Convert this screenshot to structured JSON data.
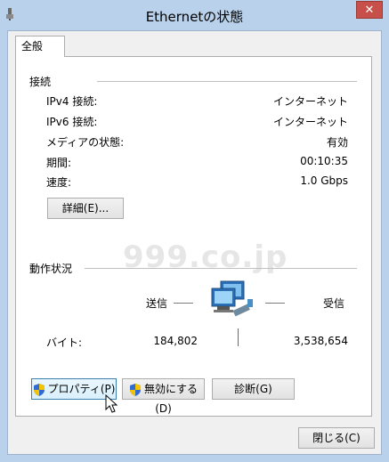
{
  "window": {
    "title": "Ethernetの状態",
    "close_label": "✕"
  },
  "tabs": [
    {
      "label": "全般"
    }
  ],
  "connection": {
    "group_title": "接続",
    "rows": [
      {
        "label": "IPv4 接続:",
        "value": "インターネット"
      },
      {
        "label": "IPv6 接続:",
        "value": "インターネット"
      },
      {
        "label": "メディアの状態:",
        "value": "有効"
      },
      {
        "label": "期間:",
        "value": "00:10:35"
      },
      {
        "label": "速度:",
        "value": "1.0 Gbps"
      }
    ],
    "details_button": "詳細(E)..."
  },
  "activity": {
    "group_title": "動作状況",
    "sent_label": "送信",
    "received_label": "受信",
    "bytes_label": "バイト:",
    "bytes_sent": "184,802",
    "bytes_received": "3,538,654"
  },
  "actions": {
    "properties_button": "プロパティ(P)",
    "disable_button": "無効にする(D)",
    "diagnose_button": "診断(G)"
  },
  "footer": {
    "close_button": "閉じる(C)"
  },
  "watermark": "999.co.jp"
}
